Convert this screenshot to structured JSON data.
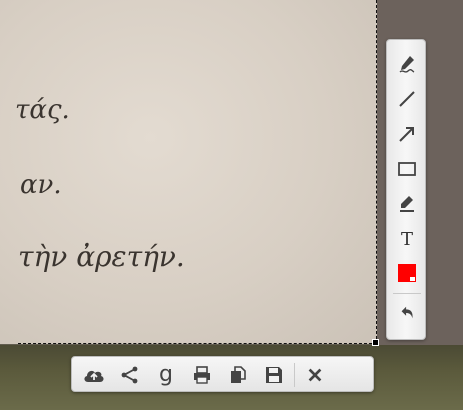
{
  "document": {
    "lines": [
      "τάς.",
      "αν.",
      "τὴν ἀρετήν."
    ]
  },
  "vertical_toolbar": {
    "tools": [
      {
        "name": "freehand-tool",
        "icon": "pen-squiggle-icon"
      },
      {
        "name": "line-tool",
        "icon": "line-icon"
      },
      {
        "name": "arrow-tool",
        "icon": "arrow-icon"
      },
      {
        "name": "rectangle-tool",
        "icon": "rectangle-icon"
      },
      {
        "name": "marker-tool",
        "icon": "marker-icon"
      },
      {
        "name": "text-tool",
        "icon": "text-icon",
        "label": "T"
      },
      {
        "name": "color-picker",
        "icon": "color-swatch-icon",
        "color": "#ff0000"
      },
      {
        "name": "undo-tool",
        "icon": "undo-icon"
      }
    ]
  },
  "horizontal_toolbar": {
    "tools": [
      {
        "name": "upload-button",
        "icon": "cloud-upload-icon"
      },
      {
        "name": "share-button",
        "icon": "share-icon"
      },
      {
        "name": "search-google-button",
        "icon": "google-icon",
        "label": "g"
      },
      {
        "name": "print-button",
        "icon": "print-icon"
      },
      {
        "name": "copy-button",
        "icon": "copy-icon"
      },
      {
        "name": "save-button",
        "icon": "save-icon"
      },
      {
        "name": "close-button",
        "icon": "close-icon"
      }
    ]
  },
  "colors": {
    "accent": "#ff0000",
    "toolbar_bg": "#f2f2f2",
    "icon": "#444444"
  }
}
